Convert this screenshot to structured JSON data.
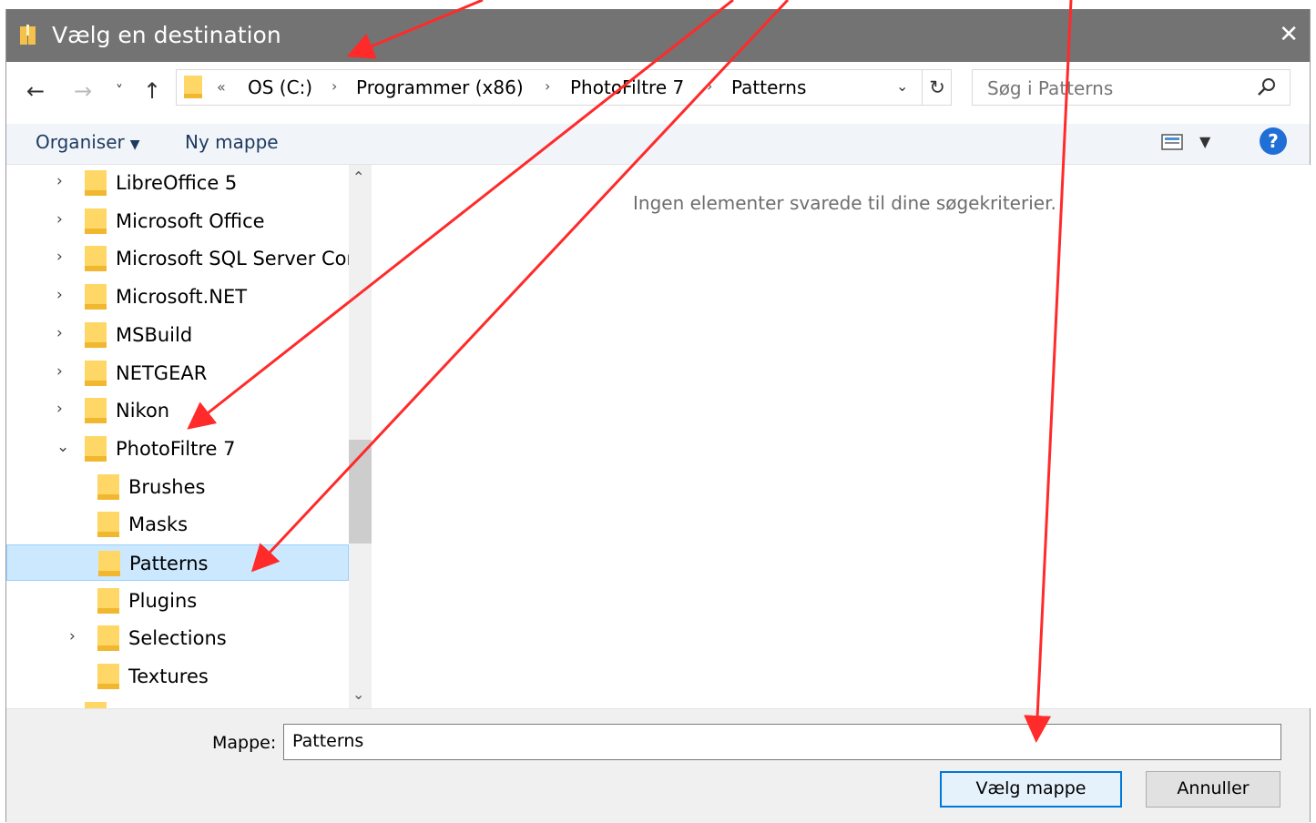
{
  "window": {
    "title": "Vælg en destination",
    "close_glyph": "✕"
  },
  "nav": {
    "back_glyph": "←",
    "forward_glyph": "→",
    "recent_glyph": "˅",
    "up_glyph": "↑"
  },
  "address": {
    "overflow_glyph": "«",
    "crumbs": [
      "OS (C:)",
      "Programmer (x86)",
      "PhotoFiltre 7",
      "Patterns"
    ],
    "separator_glyph": "›",
    "dropdown_glyph": "⌄",
    "refresh_glyph": "↻"
  },
  "search": {
    "placeholder": "Søg i Patterns"
  },
  "toolbar": {
    "organise_label": "Organiser",
    "new_folder_label": "Ny mappe",
    "help_glyph": "?"
  },
  "tree": {
    "items": [
      {
        "label": "LibreOffice 5",
        "expander": "›"
      },
      {
        "label": "Microsoft Office",
        "expander": "›"
      },
      {
        "label": "Microsoft SQL Server Cor",
        "expander": "›"
      },
      {
        "label": "Microsoft.NET",
        "expander": "›"
      },
      {
        "label": "MSBuild",
        "expander": "›"
      },
      {
        "label": "NETGEAR",
        "expander": "›"
      },
      {
        "label": "Nikon",
        "expander": "›"
      },
      {
        "label": "PhotoFiltre 7",
        "expander": "⌄"
      },
      {
        "label": "Brushes",
        "expander": ""
      },
      {
        "label": "Masks",
        "expander": ""
      },
      {
        "label": "Patterns",
        "expander": ""
      },
      {
        "label": "Plugins",
        "expander": ""
      },
      {
        "label": "Selections",
        "expander": "›"
      },
      {
        "label": "Textures",
        "expander": ""
      }
    ],
    "selected": "Patterns"
  },
  "scrollbar": {
    "up_glyph": "⌃",
    "down_glyph": "⌄"
  },
  "content": {
    "empty_message": "Ingen elementer svarede til dine søgekriterier."
  },
  "footer": {
    "folder_label": "Mappe:",
    "folder_value": "Patterns",
    "select_button": "Vælg mappe",
    "cancel_button": "Annuller"
  },
  "colors": {
    "titlebar": "#737373",
    "selection": "#cce8ff",
    "annotation_arrow": "#ff2a2a",
    "folder_yellow": "#ffd766"
  },
  "icons": [
    "folder-icon",
    "search-icon",
    "view-options-icon",
    "help-icon",
    "refresh-icon"
  ]
}
